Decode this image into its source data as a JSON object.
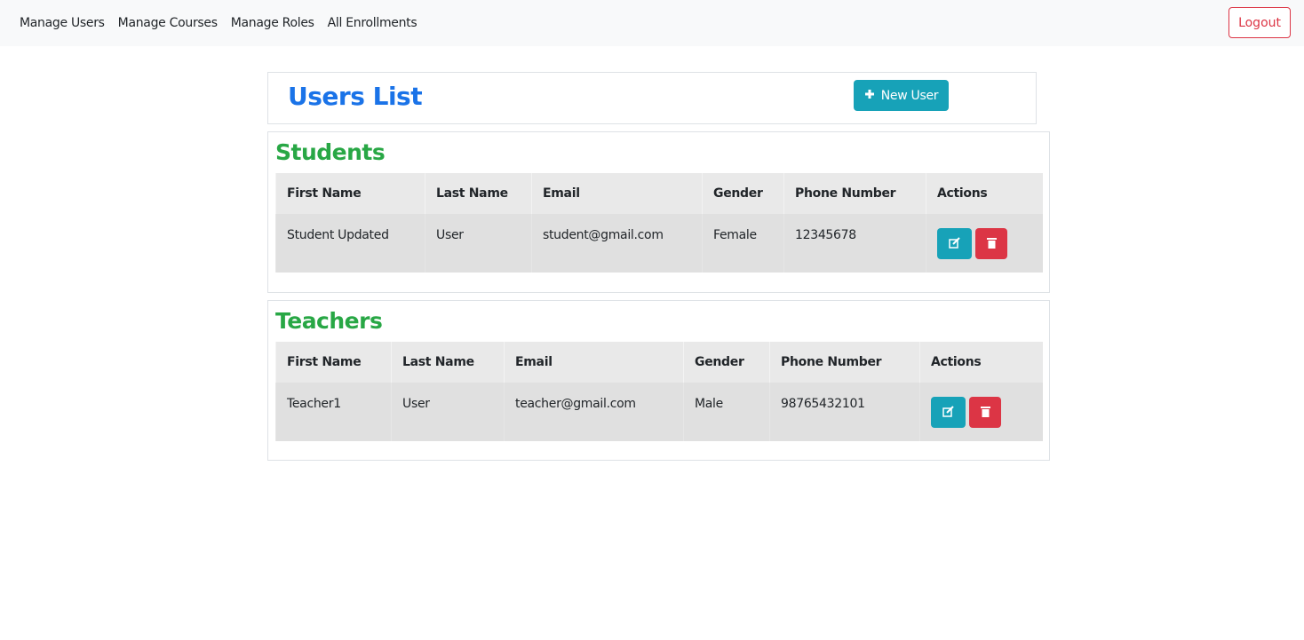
{
  "nav": {
    "items": [
      "Manage Users",
      "Manage Courses",
      "Manage Roles",
      "All Enrollments"
    ],
    "logout": "Logout"
  },
  "header": {
    "title": "Users List",
    "new_user": "New User"
  },
  "students": {
    "title": "Students",
    "columns": [
      "First Name",
      "Last Name",
      "Email",
      "Gender",
      "Phone Number",
      "Actions"
    ],
    "rows": [
      {
        "first": "Student Updated",
        "last": "User",
        "email": "student@gmail.com",
        "gender": "Female",
        "phone": "12345678"
      }
    ]
  },
  "teachers": {
    "title": "Teachers",
    "columns": [
      "First Name",
      "Last Name",
      "Email",
      "Gender",
      "Phone Number",
      "Actions"
    ],
    "rows": [
      {
        "first": "Teacher1",
        "last": "User",
        "email": "teacher@gmail.com",
        "gender": "Male",
        "phone": "98765432101"
      }
    ]
  },
  "colors": {
    "primary": "#1a73e8",
    "success": "#28a745",
    "info": "#17a2b8",
    "danger": "#dc3545"
  }
}
